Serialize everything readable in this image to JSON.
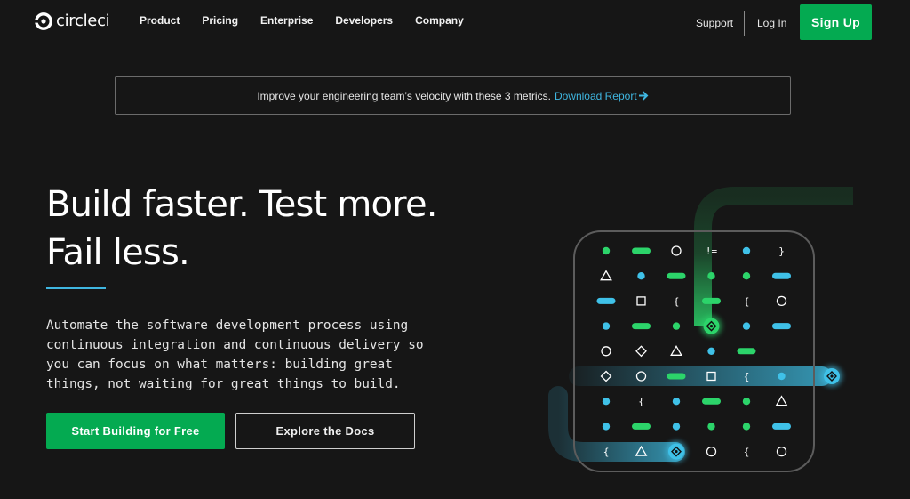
{
  "nav": {
    "logo_text": "circleci",
    "links": [
      "Product",
      "Pricing",
      "Enterprise",
      "Developers",
      "Company"
    ],
    "support": "Support",
    "login": "Log In",
    "signup": "Sign Up"
  },
  "banner": {
    "text": "Improve your engineering team’s velocity with these 3 metrics.",
    "link": "Download Report",
    "arrow_icon": "arrow-right-icon"
  },
  "hero": {
    "title_line1": "Build faster. Test more.",
    "title_line2": "Fail less.",
    "description": "Automate the software development process using continuous integration and continuous delivery so you can focus on what matters: building great things, not waiting for great things to build.",
    "primary_cta": "Start Building for Free",
    "secondary_cta": "Explore the Docs"
  },
  "illustration": {
    "grid_rows": [
      [
        "dot-green",
        "pill-green",
        "circle",
        "neq",
        "dot-blue",
        "brace-close"
      ],
      [
        "triangle",
        "dot-blue",
        "pill-green",
        "dot-green",
        "dot-green",
        "pill-blue"
      ],
      [
        "pill-blue",
        "square",
        "brace-open",
        "pill-green",
        "brace-open",
        "circle"
      ],
      [
        "dot-blue",
        "pill-green",
        "dot-green",
        "node-green",
        "dot-blue",
        "pill-blue"
      ],
      [
        "circle",
        "diamond",
        "triangle",
        "dot-blue",
        "pill-green",
        "blank"
      ],
      [
        "diamond",
        "circle",
        "pill-green",
        "square",
        "brace-open",
        "dot-blue"
      ],
      [
        "dot-blue",
        "brace-open",
        "dot-blue",
        "pill-green",
        "dot-green",
        "triangle"
      ],
      [
        "dot-blue",
        "pill-green",
        "dot-blue",
        "dot-green",
        "dot-green",
        "pill-blue"
      ],
      [
        "brace-open",
        "triangle",
        "node-blue",
        "circle",
        "brace-open",
        "circle"
      ]
    ],
    "neq_symbol": "!=",
    "brace_open_symbol": "{",
    "brace_close_symbol": "}",
    "colors": {
      "green": "#2cd46a",
      "blue": "#3fc1e8",
      "outline": "#ffffff",
      "panel_border": "#5c5c5c"
    }
  },
  "colors": {
    "background": "#161616",
    "brand_green": "#04aa51",
    "accent_blue": "#3fb6e0"
  }
}
